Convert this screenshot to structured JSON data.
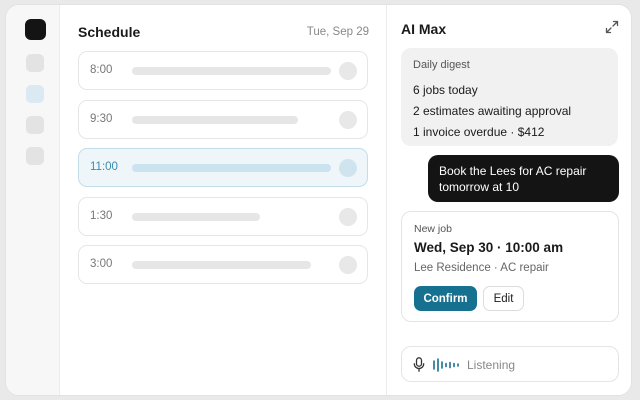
{
  "rail": {
    "nav_count": 4,
    "active_index": 1
  },
  "schedule": {
    "title": "Schedule",
    "date": "Tue, Sep 29",
    "slots": [
      {
        "time": "8:00",
        "fill": 0.78,
        "selected": false
      },
      {
        "time": "9:30",
        "fill": 0.65,
        "selected": false
      },
      {
        "time": "11:00",
        "fill": 0.78,
        "selected": true
      },
      {
        "time": "1:30",
        "fill": 0.5,
        "selected": false
      },
      {
        "time": "3:00",
        "fill": 0.7,
        "selected": false
      }
    ]
  },
  "assistant": {
    "title": "AI Max",
    "digest": {
      "heading": "Daily digest",
      "items": [
        "6 jobs today",
        "2 estimates awaiting approval",
        "1 invoice overdue · $412"
      ]
    },
    "user_message": "Book the Lees for AC repair tomorrow at 10",
    "job_card": {
      "heading": "New job",
      "when": "Wed, Sep 30 · 10:00 am",
      "details": "Lee Residence · AC repair",
      "confirm_label": "Confirm",
      "edit_label": "Edit"
    },
    "voice": {
      "status": "Listening"
    }
  },
  "colors": {
    "accent": "#16708f",
    "selected_slot": "#eef6fa",
    "dark": "#141414"
  }
}
